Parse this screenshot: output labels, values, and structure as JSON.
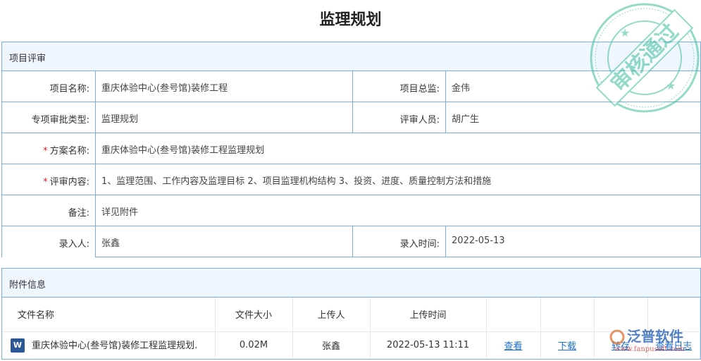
{
  "title": "监理规划",
  "review": {
    "section_title": "项目评审",
    "project_name_label": "项目名称:",
    "project_name": "重庆体验中心(叁号馆)装修工程",
    "director_label": "项目总监:",
    "director": "金伟",
    "type_label": "专项审批类型:",
    "type": "监理规划",
    "reviewer_label": "评审人员:",
    "reviewer": "胡广生",
    "plan_label": "方案名称:",
    "plan": "重庆体验中心(叁号馆)装修工程监理规划",
    "content_label": "评审内容:",
    "content": "1、监理范围、工作内容及监理目标 2、项目监理机构结构 3、投资、进度、质量控制方法和措施",
    "remark_label": "备注:",
    "remark": "详见附件",
    "entered_by_label": "录入人:",
    "entered_by": "张鑫",
    "entered_time_label": "录入时间:",
    "entered_time": "2022-05-13",
    "required_mark": "*"
  },
  "attachments": {
    "section_title": "附件信息",
    "columns": [
      "文件名称",
      "文件大小",
      "上传人",
      "上传时间"
    ],
    "rows": [
      {
        "name": "重庆体验中心(叁号馆)装修工程监理规划.",
        "size": "0.02M",
        "uploader": "张鑫",
        "time": "2022-05-13 11:11",
        "view": "查看",
        "download": "下载",
        "save": "转存",
        "log": "查看日志"
      }
    ]
  },
  "stamp_text": "审核通过",
  "logo": {
    "name": "泛普软件",
    "url": "www.fanpusoft.com"
  },
  "colors": {
    "border": "#7aaee0",
    "link": "#1a6fd0",
    "stamp": "#3cbf98"
  }
}
